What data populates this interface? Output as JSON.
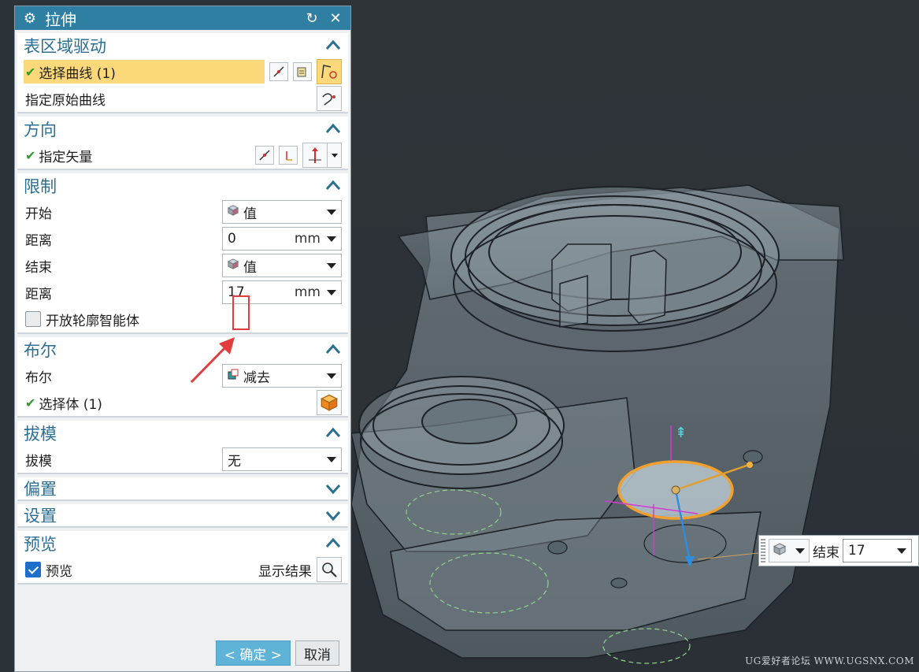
{
  "dialog": {
    "title": "拉伸",
    "sections": {
      "section_drive": {
        "title": "表区域驱动",
        "select_curve": "选择曲线 (1)",
        "specify_original": "指定原始曲线"
      },
      "direction": {
        "title": "方向",
        "specify_vector": "指定矢量"
      },
      "limits": {
        "title": "限制",
        "start_label": "开始",
        "start_value": "值",
        "start_dist_label": "距离",
        "start_dist": "0",
        "end_label": "结束",
        "end_value": "值",
        "end_dist_label": "距离",
        "end_dist": "17",
        "unit": "mm",
        "open_profile": "开放轮廓智能体"
      },
      "boolean": {
        "title": "布尔",
        "bool_label": "布尔",
        "bool_value": "减去",
        "select_body": "选择体 (1)"
      },
      "draft": {
        "title": "拔模",
        "draft_label": "拔模",
        "draft_value": "无"
      },
      "offset": {
        "title": "偏置"
      },
      "settings": {
        "title": "设置"
      },
      "preview": {
        "title": "预览",
        "preview_label": "预览",
        "show_result": "显示结果"
      }
    },
    "ok_label": "< 确定 >",
    "cancel_label": "取消"
  },
  "onscreen": {
    "end_label": "结束",
    "end_value": "17"
  },
  "watermark": "UG爱好者论坛 WWW.UGSNX.COM",
  "colors": {
    "title_bar": "#2f7fa3",
    "section_title": "#2b6f93",
    "highlight": "#fbd97b",
    "annotation": "#e23c3c",
    "profile_edge": "#f0a030"
  },
  "icons": [
    "settings-icon",
    "reset-icon",
    "close-icon",
    "chevron-up-icon",
    "chevron-down-icon",
    "check-icon",
    "cube-icon",
    "search-icon"
  ]
}
